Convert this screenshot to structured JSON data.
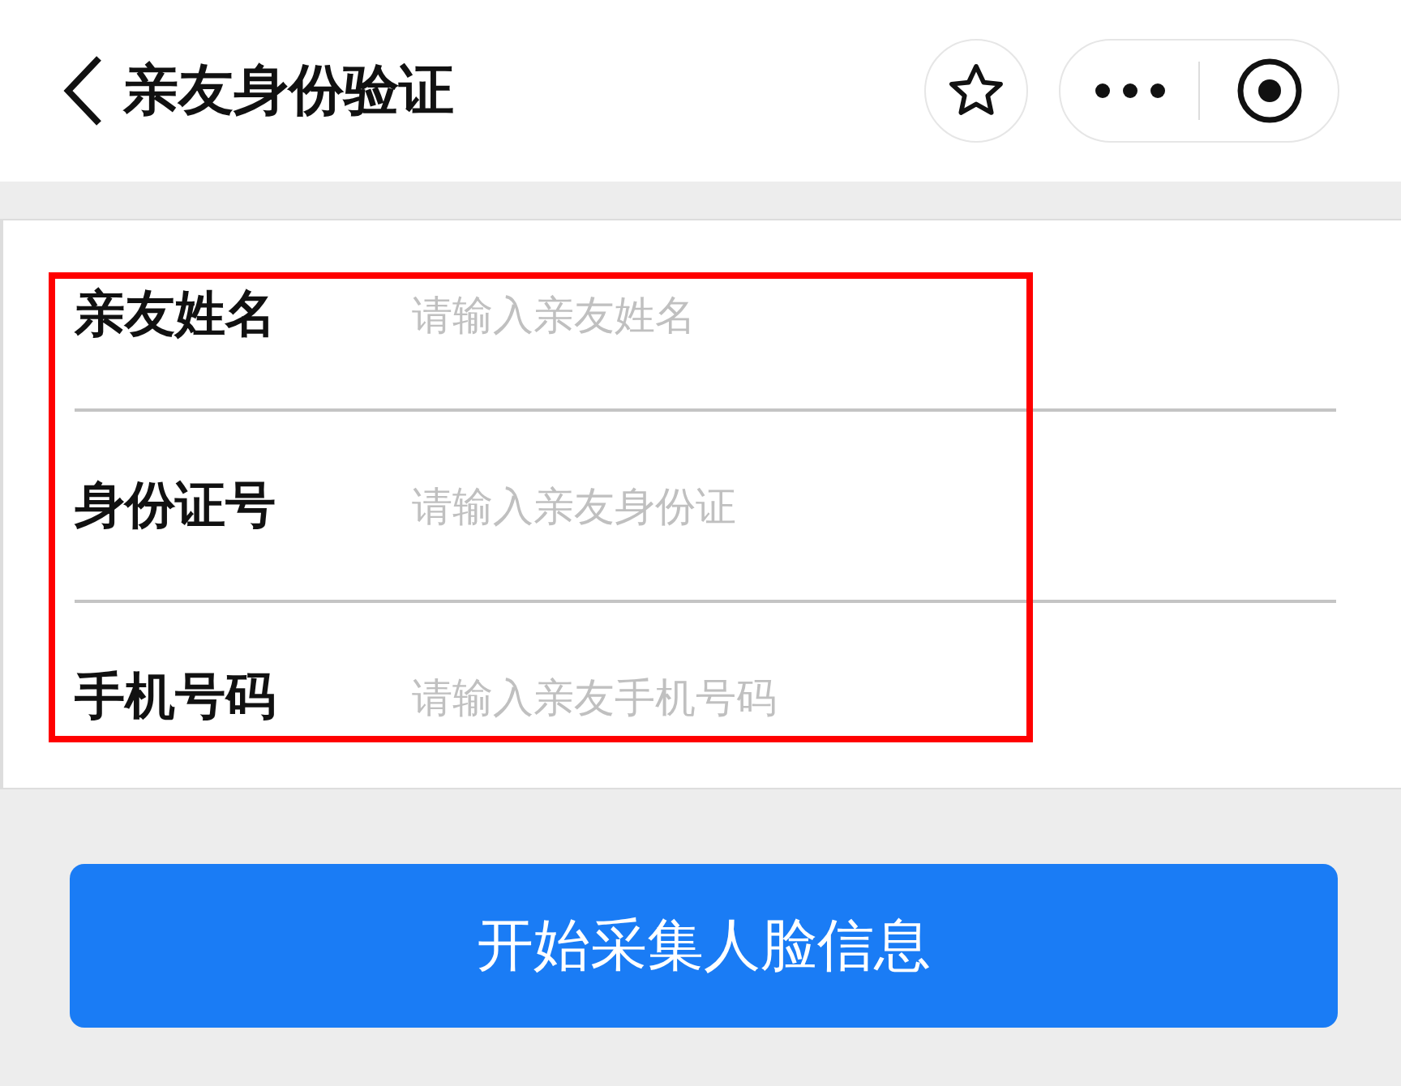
{
  "header": {
    "title": "亲友身份验证"
  },
  "form": {
    "fields": [
      {
        "label": "亲友姓名",
        "placeholder": "请输入亲友姓名"
      },
      {
        "label": "身份证号",
        "placeholder": "请输入亲友身份证"
      },
      {
        "label": "手机号码",
        "placeholder": "请输入亲友手机号码"
      }
    ],
    "annotation": {
      "kind": "box",
      "color": "#ff0000"
    }
  },
  "button": {
    "label": "开始采集人脸信息"
  }
}
